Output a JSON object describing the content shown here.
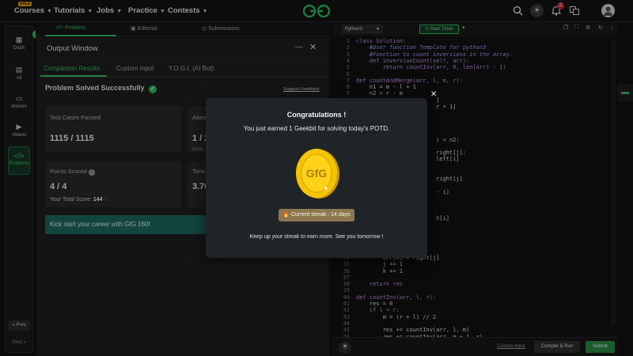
{
  "topnav": {
    "sale_badge": "SALE",
    "items": [
      {
        "label": "Courses"
      },
      {
        "label": "Tutorials"
      },
      {
        "label": "Jobs"
      },
      {
        "label": "Practice"
      },
      {
        "label": "Contests"
      }
    ],
    "logo_text": "GfG",
    "notification_count": "2"
  },
  "sidebar": {
    "items": [
      {
        "label": "Dash",
        "icon": "dashboard-icon"
      },
      {
        "label": "All",
        "icon": "grid-icon"
      },
      {
        "label": "Articles",
        "icon": "article-icon"
      },
      {
        "label": "Videos",
        "icon": "video-icon"
      },
      {
        "label": "Problems",
        "icon": "code-icon"
      }
    ],
    "prev_label": "Prev",
    "next_label": "Next"
  },
  "problem_tabs": [
    {
      "label": "Problem"
    },
    {
      "label": "Editorial"
    },
    {
      "label": "Submissions"
    }
  ],
  "output_window": {
    "title": "Output Window",
    "tabs": [
      {
        "label": "Compilation Results"
      },
      {
        "label": "Custom Input"
      },
      {
        "label": "Y.O.G.I. (AI Bot)"
      }
    ],
    "status": "Problem Solved Successfully",
    "suggest_feedback": "Suggest Feedback",
    "test_cases_label": "Test Cases Passed",
    "test_cases_value": "1115 / 1115",
    "attempts_label": "Attem",
    "attempts_value": "1 / 2",
    "accuracy_label": "Accu",
    "points_label": "Points Scored",
    "points_value": "4 / 4",
    "total_score_label": "Your Total Score:",
    "total_score_value": "144",
    "time_label": "Time",
    "time_value": "3.76",
    "banner": "Kick start your career with GfG 160!"
  },
  "editor": {
    "language": "Python3",
    "start_timer": "Start Timer",
    "custom_input": "Custom Input",
    "compile_run": "Compile & Run",
    "submit": "Submit",
    "lines": [
      {
        "n": "1",
        "code": "class Solution:"
      },
      {
        "n": "2",
        "code": "    #User function Template for python3"
      },
      {
        "n": "3",
        "code": "    #Function to count inversions in the array."
      },
      {
        "n": "4",
        "code": "    def inversionCount(self, arr):"
      },
      {
        "n": "5",
        "code": "        return countInv(arr, 0, len(arr) - 1)"
      },
      {
        "n": "6",
        "code": ""
      },
      {
        "n": "7",
        "code": "def countAndMerge(arr, l, m, r):"
      },
      {
        "n": "8",
        "code": "    n1 = m - l + 1"
      },
      {
        "n": "9",
        "code": "    n2 = r - m"
      },
      {
        "n": "10",
        "code": "                        ]"
      },
      {
        "n": "11",
        "code": "                        r + 1]"
      },
      {
        "n": "12",
        "code": ""
      },
      {
        "n": "13",
        "code": ""
      },
      {
        "n": "14",
        "code": ""
      },
      {
        "n": "15",
        "code": ""
      },
      {
        "n": "16",
        "code": "                        ) < n2:"
      },
      {
        "n": "17",
        "code": ""
      },
      {
        "n": "18",
        "code": "                        right[j]:"
      },
      {
        "n": "19",
        "code": "                        left[i]"
      },
      {
        "n": "20",
        "code": ""
      },
      {
        "n": "21",
        "code": ""
      },
      {
        "n": "22",
        "code": "                        right[j]"
      },
      {
        "n": "23",
        "code": ""
      },
      {
        "n": "24",
        "code": "                        - i)"
      },
      {
        "n": "25",
        "code": ""
      },
      {
        "n": "26",
        "code": ""
      },
      {
        "n": "27",
        "code": ""
      },
      {
        "n": "28",
        "code": "                        t[i]"
      },
      {
        "n": "29",
        "code": ""
      },
      {
        "n": "30",
        "code": ""
      },
      {
        "n": "31",
        "code": ""
      },
      {
        "n": "32",
        "code": ""
      },
      {
        "n": "33",
        "code": ""
      },
      {
        "n": "34",
        "code": "        arr[k] = right[j]"
      },
      {
        "n": "35",
        "code": "        j += 1"
      },
      {
        "n": "36",
        "code": "        k += 1"
      },
      {
        "n": "37",
        "code": ""
      },
      {
        "n": "38",
        "code": "    return res"
      },
      {
        "n": "39",
        "code": ""
      },
      {
        "n": "40",
        "code": "def countInv(arr, l, r):"
      },
      {
        "n": "41",
        "code": "    res = 0"
      },
      {
        "n": "42",
        "code": "    if l < r:"
      },
      {
        "n": "43",
        "code": "        m = (r + l) // 2"
      },
      {
        "n": "44",
        "code": ""
      },
      {
        "n": "45",
        "code": "        res += countInv(arr, l, m)"
      },
      {
        "n": "46",
        "code": "        res += countInv(arr, m + 1, r)"
      }
    ]
  },
  "modal": {
    "title": "Congratulations !",
    "message": "You just earned 1 Geekbit for solving today's POTD.",
    "coin_text": "GfG",
    "streak": "Current streak : 14 days",
    "footer": "Keep up your streak to earn more. See you tomorrow !"
  },
  "colors": {
    "accent_green": "#2fbf60",
    "coin_gold": "#f5c400",
    "streak_bg": "#8d7750"
  }
}
